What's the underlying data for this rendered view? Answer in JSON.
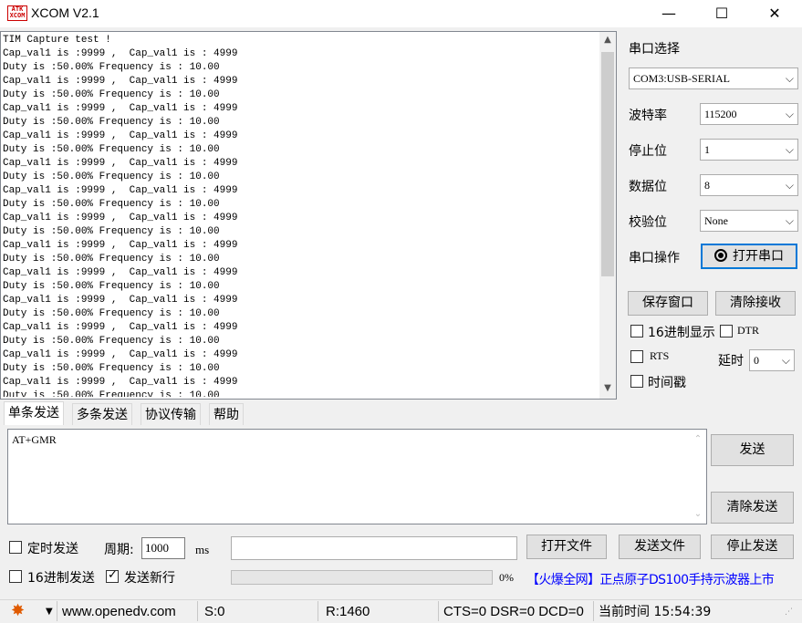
{
  "window": {
    "title": "XCOM V2.1",
    "icon_text": "ATK\nXCOM",
    "minimize": "—",
    "maximize": "☐",
    "close": "✕"
  },
  "receive": {
    "text": "TIM Capture test !\nCap_val1 is :9999 ,  Cap_val1 is : 4999\nDuty is :50.00% Frequency is : 10.00\nCap_val1 is :9999 ,  Cap_val1 is : 4999\nDuty is :50.00% Frequency is : 10.00\nCap_val1 is :9999 ,  Cap_val1 is : 4999\nDuty is :50.00% Frequency is : 10.00\nCap_val1 is :9999 ,  Cap_val1 is : 4999\nDuty is :50.00% Frequency is : 10.00\nCap_val1 is :9999 ,  Cap_val1 is : 4999\nDuty is :50.00% Frequency is : 10.00\nCap_val1 is :9999 ,  Cap_val1 is : 4999\nDuty is :50.00% Frequency is : 10.00\nCap_val1 is :9999 ,  Cap_val1 is : 4999\nDuty is :50.00% Frequency is : 10.00\nCap_val1 is :9999 ,  Cap_val1 is : 4999\nDuty is :50.00% Frequency is : 10.00\nCap_val1 is :9999 ,  Cap_val1 is : 4999\nDuty is :50.00% Frequency is : 10.00\nCap_val1 is :9999 ,  Cap_val1 is : 4999\nDuty is :50.00% Frequency is : 10.00\nCap_val1 is :9999 ,  Cap_val1 is : 4999\nDuty is :50.00% Frequency is : 10.00\nCap_val1 is :9999 ,  Cap_val1 is : 4999\nDuty is :50.00% Frequency is : 10.00\nCap_val1 is :9999 ,  Cap_val1 is : 4999\nDuty is :50.00% Frequency is : 10.00"
  },
  "serial": {
    "port_label": "串口选择",
    "port_value": "COM3:USB-SERIAL",
    "baud_label": "波特率",
    "baud_value": "115200",
    "stop_label": "停止位",
    "stop_value": "1",
    "data_label": "数据位",
    "data_value": "8",
    "parity_label": "校验位",
    "parity_value": "None",
    "op_label": "串口操作",
    "open_button": "打开串口"
  },
  "options": {
    "save_window": "保存窗口",
    "clear_receive": "清除接收",
    "hex_display": "16进制显示",
    "dtr": "DTR",
    "rts": "RTS",
    "delay_label": "延时",
    "delay_value": "0",
    "timestamp": "时间戳"
  },
  "tabs": [
    "单条发送",
    "多条发送",
    "协议传输",
    "帮助"
  ],
  "send": {
    "text": "AT+GMR",
    "send_button": "发送",
    "clear_send_button": "清除发送",
    "timed_send": "定时发送",
    "period_label": "周期:",
    "period_value": "1000",
    "period_unit": "ms",
    "open_file": "打开文件",
    "send_file": "发送文件",
    "stop_send": "停止发送",
    "hex_send": "16进制发送",
    "send_newline": "发送新行",
    "progress": 0,
    "progress_text": "0%",
    "promo": "【火爆全网】正点原子DS100手持示波器上市"
  },
  "status": {
    "site": "www.openedv.com",
    "sent": "S:0",
    "received": "R:1460",
    "lines": "CTS=0 DSR=0 DCD=0",
    "time": "当前时间 15:54:39"
  },
  "colors": {
    "promo": "#0000ff",
    "gear": "#e05a00",
    "focus": "#0078d7"
  }
}
